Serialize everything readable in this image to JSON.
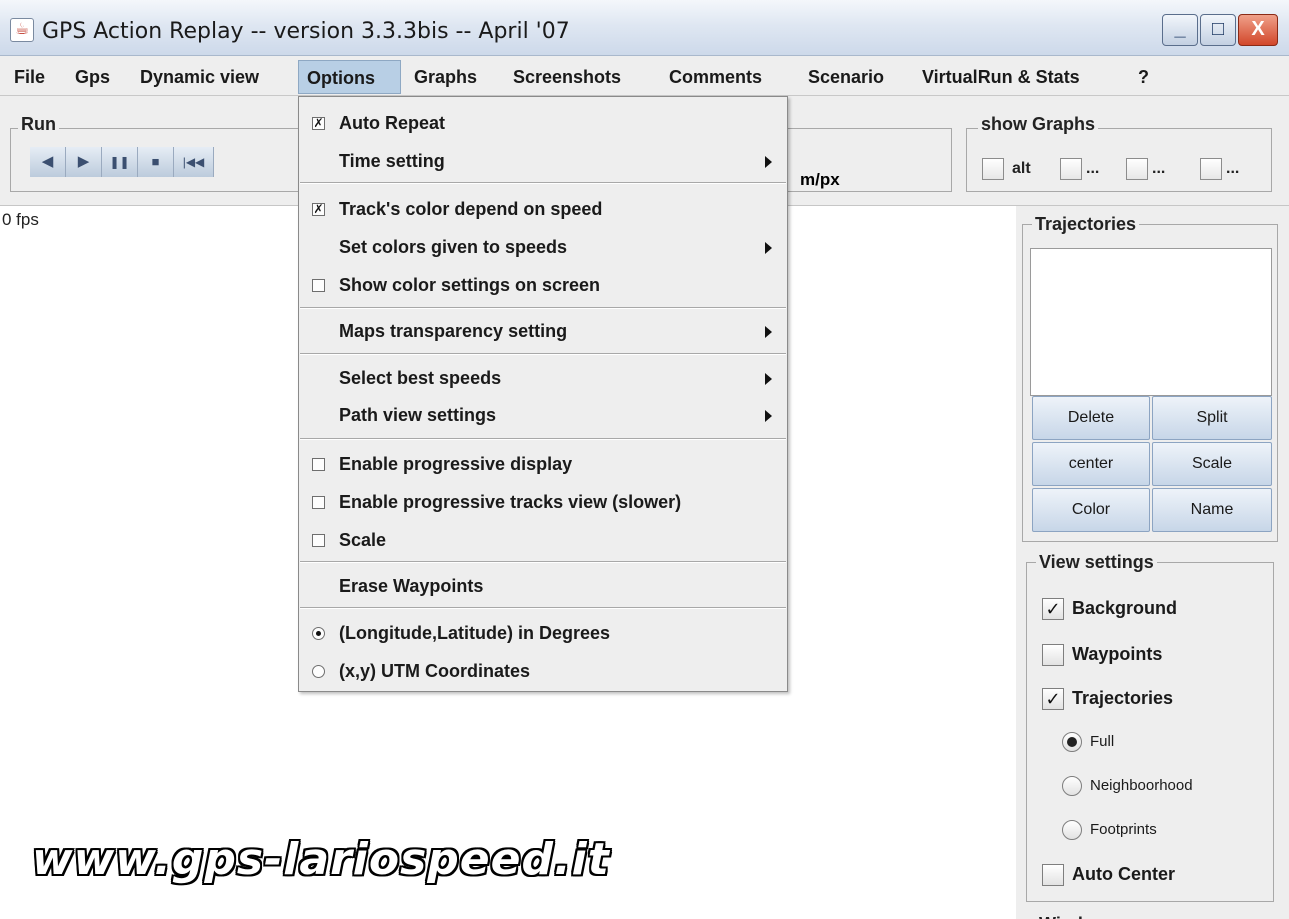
{
  "window": {
    "title": "GPS Action Replay -- version 3.3.3bis -- April '07",
    "minimize_glyph": "_",
    "maximize_glyph": "□",
    "close_glyph": "X"
  },
  "menubar": {
    "items": [
      "File",
      "Gps",
      "Dynamic view",
      "Options",
      "Graphs",
      "Screenshots",
      "Comments",
      "Scenario",
      "VirtualRun & Stats",
      "?"
    ],
    "active": "Options"
  },
  "run_group": {
    "title": "Run",
    "buttons": [
      {
        "icon": "step-back-icon",
        "glyph": "◀"
      },
      {
        "icon": "play-icon",
        "glyph": "▶"
      },
      {
        "icon": "pause-icon",
        "glyph": "❚❚"
      },
      {
        "icon": "stop-icon",
        "glyph": "■"
      },
      {
        "icon": "rewind-to-start-icon",
        "glyph": "|◀◀"
      }
    ]
  },
  "scale_unit": "m/px",
  "show_graphs": {
    "title": "show Graphs",
    "items": [
      {
        "label": "alt",
        "checked": false
      },
      {
        "label": "...",
        "checked": false
      },
      {
        "label": "...",
        "checked": false
      },
      {
        "label": "...",
        "checked": false
      }
    ]
  },
  "main": {
    "fps": "0 fps",
    "watermark": "www.gps-lariospeed.it"
  },
  "trajectories": {
    "title": "Trajectories",
    "buttons": [
      "Delete",
      "Split",
      "center",
      "Scale",
      "Color",
      "Name"
    ]
  },
  "view_settings": {
    "title": "View settings",
    "background": {
      "label": "Background",
      "checked": true
    },
    "waypoints": {
      "label": "Waypoints",
      "checked": false
    },
    "trajectories": {
      "label": "Trajectories",
      "checked": true
    },
    "modes": [
      {
        "label": "Full",
        "selected": true
      },
      {
        "label": "Neighboorhood",
        "selected": false
      },
      {
        "label": "Footprints",
        "selected": false
      }
    ],
    "auto_center": {
      "label": "Auto Center",
      "checked": false
    },
    "next_group_partial": "Wind"
  },
  "options_menu": {
    "auto_repeat": {
      "label": "Auto Repeat",
      "checked": true
    },
    "time_setting": {
      "label": "Time setting"
    },
    "track_color_speed": {
      "label": "Track's color depend on speed",
      "checked": true
    },
    "set_colors": {
      "label": "Set colors given to speeds"
    },
    "show_color_settings": {
      "label": "Show color settings on screen",
      "checked": false
    },
    "maps_transparency": {
      "label": "Maps transparency setting"
    },
    "select_best_speeds": {
      "label": "Select best speeds"
    },
    "path_view_settings": {
      "label": "Path view settings"
    },
    "progressive_display": {
      "label": "Enable progressive display",
      "checked": false
    },
    "progressive_tracks": {
      "label": "Enable progressive tracks view (slower)",
      "checked": false
    },
    "scale": {
      "label": "Scale",
      "checked": false
    },
    "erase_waypoints": {
      "label": "Erase Waypoints"
    },
    "coord_degrees": {
      "label": "(Longitude,Latitude) in Degrees",
      "selected": true
    },
    "coord_utm": {
      "label": "(x,y) UTM Coordinates",
      "selected": false
    }
  },
  "check_glyph": "✓",
  "menu_check_glyph": "✗"
}
